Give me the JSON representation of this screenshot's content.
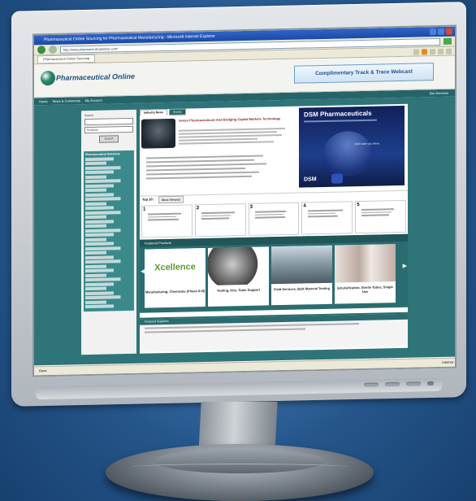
{
  "browser": {
    "window_title": "Pharmaceutical Online Sourcing for Pharmaceutical Manufacturing - Microsoft Internet Explorer",
    "url": "http://www.pharmaceuticalonline.com/",
    "tab_label": "Pharmaceutical Online Sourcing"
  },
  "site": {
    "logo_text": "Pharmaceutical Online",
    "banner_text": "Complimentary Track & Trace Webcast",
    "nav": [
      "Home",
      "News & Comments",
      "My Account"
    ],
    "nav_right": "Site Services"
  },
  "sidebar": {
    "search_label": "Search",
    "select_value": "Products",
    "search_button": "Search",
    "category_title": "Pharmaceutical Solutions"
  },
  "news": {
    "tabs": [
      "Industry News",
      "Events"
    ],
    "headline": "Vertex Pharmaceuticals And Bridging Capital Markets Technology"
  },
  "ad": {
    "title": "DSM Pharmaceuticals",
    "tagline": "We'll take you there.",
    "logo": "DSM"
  },
  "top10": {
    "label": "Top 10:",
    "tab": "Most Viewed",
    "items": [
      "1",
      "2",
      "3",
      "4",
      "5"
    ]
  },
  "featured": {
    "header": "Featured Products",
    "items": [
      {
        "caption": "Manufacturing, Chemicals (Phase II-III)",
        "image_text": "Xcellence"
      },
      {
        "caption": "Tooling, Kits, Tools Support",
        "image_text": ""
      },
      {
        "caption": "Field Services, Bulk Material Testing",
        "image_text": ""
      },
      {
        "caption": "Emulsification, Sterile Tubes, Single Use",
        "image_text": ""
      }
    ]
  },
  "feedback": {
    "header": "Featured Suppliers"
  },
  "statusbar": {
    "left": "Done",
    "right": "Internet"
  }
}
